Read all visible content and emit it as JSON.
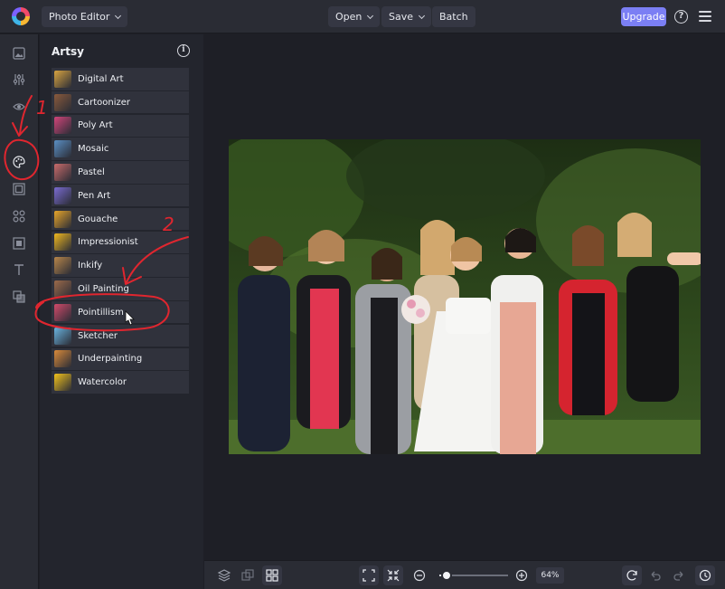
{
  "header": {
    "app_menu_label": "Photo Editor",
    "open_label": "Open",
    "save_label": "Save",
    "batch_label": "Batch",
    "upgrade_label": "Upgrade",
    "help_icon": "question-circle-icon",
    "menu_icon": "hamburger-icon"
  },
  "rail": {
    "icons": [
      "image-icon",
      "sliders-icon",
      "eye-icon",
      "palette-icon",
      "frame-icon",
      "elements-icon",
      "crop-frame-icon",
      "text-icon",
      "overlay-icon"
    ],
    "active": "palette-icon"
  },
  "panel": {
    "title": "Artsy",
    "info_icon": "info-icon",
    "effects": [
      {
        "label": "Digital Art",
        "color": "#d9a441"
      },
      {
        "label": "Cartoonizer",
        "color": "#8a5a3c"
      },
      {
        "label": "Poly Art",
        "color": "#d2457a"
      },
      {
        "label": "Mosaic",
        "color": "#5a8fc4"
      },
      {
        "label": "Pastel",
        "color": "#c96b6b"
      },
      {
        "label": "Pen Art",
        "color": "#7a6bd1"
      },
      {
        "label": "Gouache",
        "color": "#e8a52a"
      },
      {
        "label": "Impressionist",
        "color": "#f0b81f"
      },
      {
        "label": "Inkify",
        "color": "#b8864a"
      },
      {
        "label": "Oil Painting",
        "color": "#9c6a4a"
      },
      {
        "label": "Pointillism",
        "color": "#d24a6a"
      },
      {
        "label": "Sketcher",
        "color": "#6ab4e0"
      },
      {
        "label": "Underpainting",
        "color": "#d98a3a"
      },
      {
        "label": "Watercolor",
        "color": "#f2c21b"
      }
    ]
  },
  "canvas": {
    "image_description_icon": "photo-canvas"
  },
  "footer": {
    "zoom": "64%",
    "zoom_level": 0.1,
    "left_icons": [
      "layers-icon",
      "compare-icon",
      "grid-icon"
    ],
    "center_icons": [
      "fit-screen-icon",
      "actual-size-icon",
      "zoom-out-icon",
      "zoom-in-icon"
    ],
    "right_icons": [
      "reset-icon",
      "undo-icon",
      "redo-icon",
      "history-icon"
    ]
  },
  "annotations": {
    "marker_1": "1",
    "marker_2": "2",
    "color": "#e0262f"
  }
}
